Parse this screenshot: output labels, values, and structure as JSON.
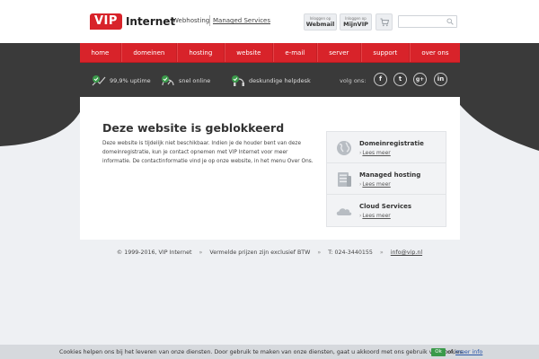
{
  "header": {
    "logo_vip": "VIP",
    "logo_internet": "Internet",
    "webhosting": "Webhosting",
    "managed": "Managed Services",
    "webmail_small": "Inloggen op",
    "webmail_big": "Webmail",
    "mijnvip_small": "Inloggen op",
    "mijnvip_big": "MijnVIP",
    "search_placeholder": ""
  },
  "nav": {
    "items": [
      {
        "label": "home"
      },
      {
        "label": "domeinen"
      },
      {
        "label": "hosting"
      },
      {
        "label": "website"
      },
      {
        "label": "e-mail"
      },
      {
        "label": "server"
      },
      {
        "label": "support"
      },
      {
        "label": "over ons"
      }
    ]
  },
  "usp": {
    "uptime": "99,9% uptime",
    "online": "snel online",
    "helpdesk": "deskundige helpdesk",
    "volg": "volg ons:"
  },
  "social": {
    "fb": "f",
    "tw": "t",
    "gp": "g+",
    "li": "in"
  },
  "main": {
    "title": "Deze website is geblokkeerd",
    "line1": "Deze website is tijdelijk niet beschikbaar. Indien je de houder bent van deze",
    "line2": "domeinregistratie, kun je contact opnemen met VIP Internet voor meer",
    "line3": "informatie. De contactinformatie vind je op onze website, in het menu Over Ons."
  },
  "sidebar": {
    "items": [
      {
        "title": "Domeinregistratie",
        "link": "Lees meer"
      },
      {
        "title": "Managed hosting",
        "link": "Lees meer"
      },
      {
        "title": "Cloud Services",
        "link": "Lees meer"
      }
    ]
  },
  "footer": {
    "copyright": "© 1999-2016, VIP Internet",
    "sep": "»",
    "prices": "Vermelde prijzen zijn exclusief BTW",
    "phone": "T: 024-3440155",
    "email": "info@vip.nl"
  },
  "cookie": {
    "text": "Cookies helpen ons bij het leveren van onze diensten. Door gebruik te maken van onze diensten, gaat u akkoord met ons gebruik van cookies.",
    "ok": "Ok",
    "of": "of,",
    "more": "meer info"
  },
  "colors": {
    "brand_red": "#d8232a",
    "dark_band": "#3a3a3a",
    "check_green": "#3a9a4a"
  }
}
